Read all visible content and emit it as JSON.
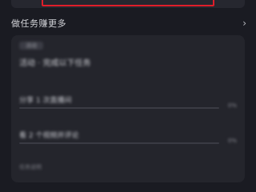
{
  "section": {
    "title": "做任务赚更多"
  },
  "task_card": {
    "tag": "活动",
    "headline": "活动 · 完成以下任务",
    "tasks": [
      {
        "label": "分享 1 次直播间",
        "progress_text": "0%",
        "progress": 0.0
      },
      {
        "label": "看 2 个视频并评论",
        "progress_text": "0%",
        "progress": 0.0
      }
    ],
    "footer": "任务说明"
  },
  "colors": {
    "background": "#1a1b22",
    "card": "#24252c",
    "highlight_border": "#e01e2a"
  }
}
